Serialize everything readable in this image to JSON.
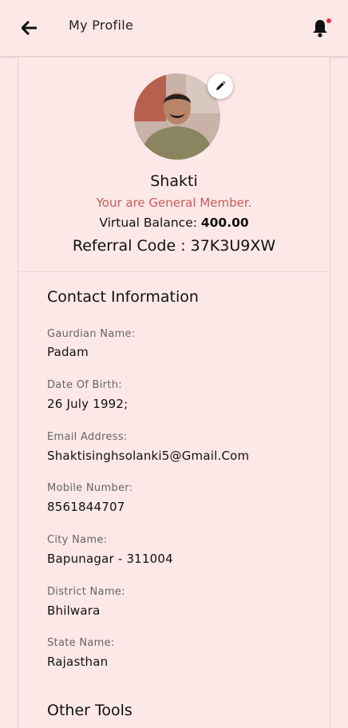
{
  "header": {
    "title": "My Profile",
    "back_icon": "arrow-left-icon",
    "notification_icon": "bell-icon"
  },
  "profile": {
    "name": "Shakti",
    "membership": "Your are General Member.",
    "balance_label": "Virtual Balance: ",
    "balance_value": "400.00",
    "referral": "Referral Code : 37K3U9XW",
    "edit_icon": "pencil-icon"
  },
  "contact": {
    "title": "Contact Information",
    "fields": [
      {
        "label": "Gaurdian Name:",
        "value": "Padam"
      },
      {
        "label": "Date Of Birth:",
        "value": "26 July 1992;"
      },
      {
        "label": "Email Address:",
        "value": "Shaktisinghsolanki5@Gmail.Com"
      },
      {
        "label": "Mobile Number:",
        "value": "8561844707"
      },
      {
        "label": "City Name:",
        "value": "Bapunagar - 311004"
      },
      {
        "label": "District Name:",
        "value": "Bhilwara"
      },
      {
        "label": "State Name:",
        "value": "Rajasthan"
      }
    ]
  },
  "other_tools": {
    "title": "Other Tools"
  },
  "colors": {
    "background": "#fde8e8",
    "member_text": "#c85a5a",
    "notification_dot": "#e0304a"
  }
}
